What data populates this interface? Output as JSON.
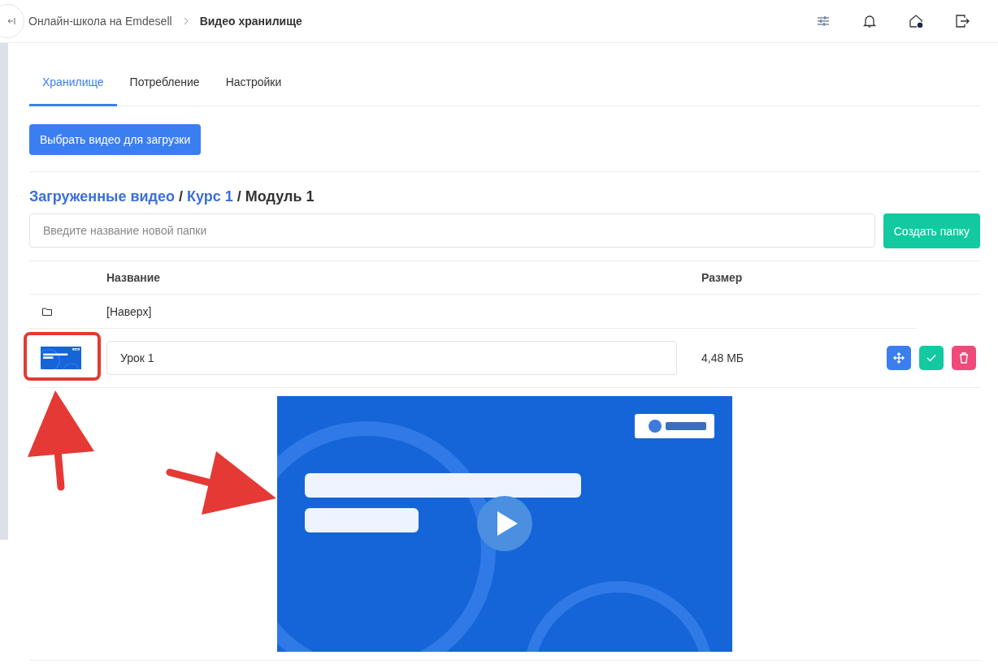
{
  "header": {
    "breadcrumb": [
      "Онлайн-школа на Emdesell",
      "Видео хранилище"
    ]
  },
  "tabs": [
    {
      "label": "Хранилище",
      "selected": true
    },
    {
      "label": "Потребление",
      "selected": false
    },
    {
      "label": "Настройки",
      "selected": false
    }
  ],
  "upload_button": "Выбрать видео для загрузки",
  "path": [
    {
      "label": "Загруженные видео",
      "kind": "link"
    },
    {
      "label": "/",
      "kind": "separator"
    },
    {
      "label": "Курс 1",
      "kind": "link"
    },
    {
      "label": "/",
      "kind": "separator"
    },
    {
      "label": "Модуль 1",
      "kind": "current"
    }
  ],
  "folder_form": {
    "placeholder": "Введите название новой папки",
    "button": "Создать папку"
  },
  "table": {
    "columns": [
      "Название",
      "Размер"
    ],
    "rows": [
      {
        "kind": "parent",
        "name": "[Наверх]"
      },
      {
        "kind": "video",
        "name": "Урок 1",
        "size": "4,48 МБ",
        "expanded": true
      }
    ]
  }
}
